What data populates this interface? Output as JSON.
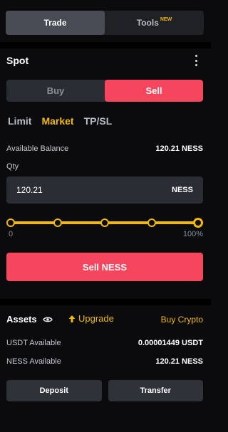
{
  "top_tabs": {
    "trade": "Trade",
    "tools": "Tools",
    "tools_badge": "NEW"
  },
  "spot": {
    "title": "Spot"
  },
  "side_tabs": {
    "buy": "Buy",
    "sell": "Sell"
  },
  "order_types": [
    "Limit",
    "Market",
    "TP/SL"
  ],
  "available_balance": {
    "label": "Available Balance",
    "value": "120.21 NESS"
  },
  "qty": {
    "label": "Qty",
    "value": "120.21",
    "unit": "NESS"
  },
  "slider": {
    "min_label": "0",
    "max_label": "100%",
    "value_percent": 100
  },
  "sell_button": "Sell NESS",
  "assets": {
    "title": "Assets",
    "upgrade": "Upgrade",
    "buy_crypto": "Buy Crypto",
    "rows": [
      {
        "label": "USDT Available",
        "value": "0.00001449 USDT"
      },
      {
        "label": "NESS Available",
        "value": "120.21 NESS"
      }
    ]
  },
  "buttons": {
    "deposit": "Deposit",
    "transfer": "Transfer"
  },
  "colors": {
    "accent": "#f0b90b",
    "sell": "#f6465d",
    "background": "#0b0b0e"
  }
}
